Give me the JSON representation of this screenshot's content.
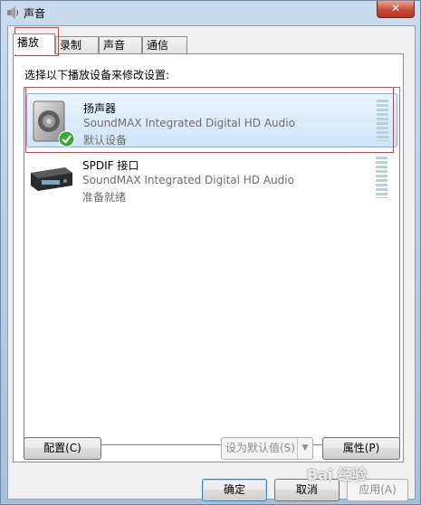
{
  "window": {
    "title": "声音",
    "close_label": "✕"
  },
  "tabs": [
    {
      "label": "播放",
      "active": true
    },
    {
      "label": "录制",
      "active": false
    },
    {
      "label": "声音",
      "active": false
    },
    {
      "label": "通信",
      "active": false
    }
  ],
  "panel": {
    "instruction": "选择以下播放设备来修改设置:"
  },
  "devices": [
    {
      "name": "扬声器",
      "description": "SoundMAX Integrated Digital HD Audio",
      "status": "默认设备",
      "selected": true,
      "icon": "speaker-icon",
      "default_badge": "checkmark-icon"
    },
    {
      "name": "SPDIF 接口",
      "description": "SoundMAX Integrated Digital HD Audio",
      "status": "准备就绪",
      "selected": false,
      "icon": "spdif-device-icon"
    }
  ],
  "buttons": {
    "configure": "配置(C)",
    "set_default": "设为默认值(S)",
    "properties": "属性(P)",
    "ok": "确定",
    "cancel": "取消",
    "apply": "应用(A)"
  },
  "watermark": "Bai 经验",
  "colors": {
    "selection_border": "#84acdd",
    "highlight_box": "#e23a3a",
    "check_green": "#3aa935"
  }
}
